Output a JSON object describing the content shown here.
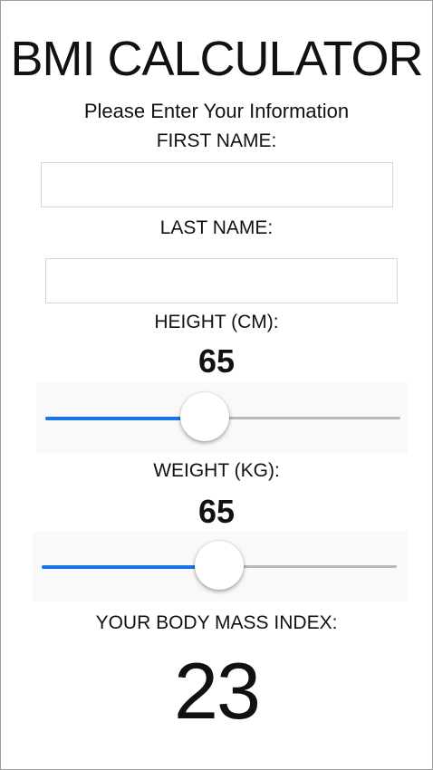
{
  "app": {
    "title": "BMI CALCULATOR",
    "subtitle": "Please Enter Your Information"
  },
  "form": {
    "first_name_label": "FIRST NAME:",
    "first_name_value": "",
    "last_name_label": "LAST NAME:",
    "last_name_value": ""
  },
  "height": {
    "label": "HEIGHT (CM):",
    "value": "65",
    "fraction": 0.45
  },
  "weight": {
    "label": "WEIGHT (KG):",
    "value": "65",
    "fraction": 0.5
  },
  "result": {
    "label": "YOUR BODY MASS INDEX:",
    "value": "23"
  },
  "colors": {
    "accent": "#1a73e8",
    "track": "#b7b7b7",
    "border": "#9e9e9e"
  }
}
